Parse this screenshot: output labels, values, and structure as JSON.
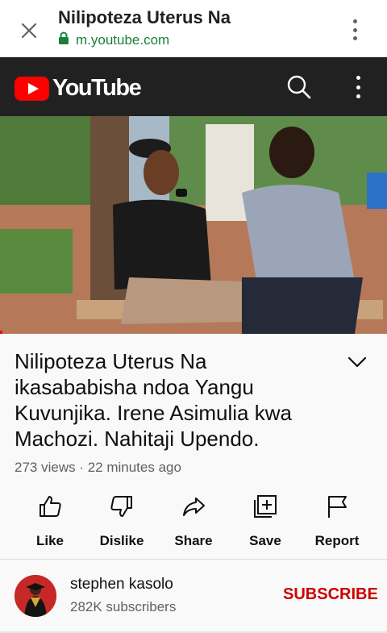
{
  "browser": {
    "page_title": "Nilipoteza Uterus Na",
    "url": "m.youtube.com",
    "icons": {
      "close": "close-icon",
      "lock": "lock-icon",
      "menu": "more-vert-icon"
    }
  },
  "youtube_header": {
    "logo_text": "YouTube",
    "icons": {
      "search": "search-icon",
      "menu": "more-vert-icon"
    },
    "colors": {
      "brand": "#ff0000",
      "header_bg": "#212121"
    }
  },
  "video": {
    "title": "Nilipoteza Uterus Na ikasababisha ndoa Yangu Kuvunjika. Irene Asimulia kwa Machozi. Nahitaji Upendo.",
    "title_lines": [
      "Nilipoteza Uterus Na",
      "ikasababisha ndoa Yangu",
      "Kuvunjika. Irene Asimulia kwa",
      "Machozi. Nahitaji Upendo."
    ],
    "meta": "273 views · 22 minutes ago"
  },
  "actions": [
    {
      "label": "Like",
      "icon": "thumbs-up-icon"
    },
    {
      "label": "Dislike",
      "icon": "thumbs-down-icon"
    },
    {
      "label": "Share",
      "icon": "share-icon"
    },
    {
      "label": "Save",
      "icon": "add-to-playlist-icon"
    },
    {
      "label": "Report",
      "icon": "flag-icon"
    }
  ],
  "channel": {
    "name": "stephen kasolo",
    "subscribers": "282K subscribers",
    "subscribe_label": "SUBSCRIBE",
    "colors": {
      "subscribe": "#cc0000"
    }
  }
}
